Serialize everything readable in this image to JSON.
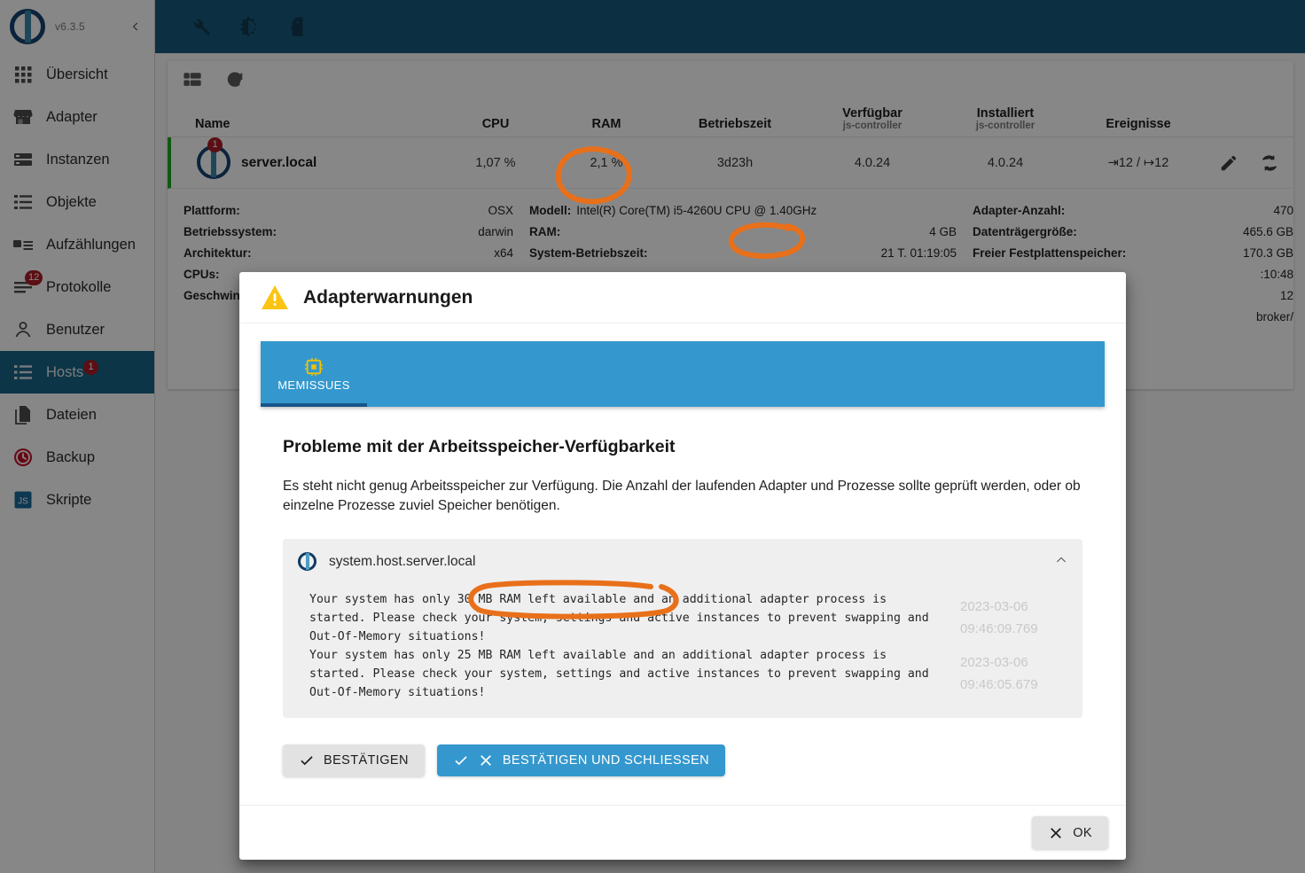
{
  "app": {
    "version": "v6.3.5",
    "logo_name": "iobroker-logo",
    "collapse_icon": "chevron-left-icon"
  },
  "appbar": {
    "icons": [
      {
        "name": "wrench-icon",
        "label": "Einstellungen"
      },
      {
        "name": "brightness-icon",
        "label": "Helligkeit"
      },
      {
        "name": "user-head-icon",
        "label": "Profil"
      }
    ]
  },
  "sidebar": {
    "items": [
      {
        "label": "Übersicht",
        "icon": "grid-dots-icon",
        "badge": null,
        "active": false
      },
      {
        "label": "Adapter",
        "icon": "store-icon",
        "badge": null,
        "active": false
      },
      {
        "label": "Instanzen",
        "icon": "cards-icon",
        "badge": null,
        "active": false
      },
      {
        "label": "Objekte",
        "icon": "list-icon",
        "badge": null,
        "active": false
      },
      {
        "label": "Aufzählungen",
        "icon": "enum-icon",
        "badge": null,
        "active": false
      },
      {
        "label": "Protokolle",
        "icon": "log-lines-icon",
        "badge": "12",
        "active": false
      },
      {
        "label": "Benutzer",
        "icon": "person-icon",
        "badge": null,
        "active": false
      },
      {
        "label": "Hosts",
        "icon": "hosts-icon",
        "badge": "1",
        "active": true
      },
      {
        "label": "Dateien",
        "icon": "files-icon",
        "badge": null,
        "active": false
      },
      {
        "label": "Backup",
        "icon": "backup-clock-icon",
        "badge": null,
        "active": false
      },
      {
        "label": "Skripte",
        "icon": "js-script-icon",
        "badge": null,
        "active": false
      }
    ]
  },
  "hosts_card": {
    "toolbar": [
      {
        "name": "toggle-expand-icon",
        "label": "Ansicht"
      },
      {
        "name": "refresh-icon",
        "label": "Aktualisieren"
      }
    ],
    "columns": {
      "name": "Name",
      "cpu": "CPU",
      "ram": "RAM",
      "uptime": "Betriebszeit",
      "available": "Verfügbar",
      "available_sub": "js-controller",
      "installed": "Installiert",
      "installed_sub": "js-controller",
      "events": "Ereignisse"
    },
    "row": {
      "host": "server.local",
      "host_badge": "1",
      "cpu": "1,07 %",
      "ram": "2,1 %",
      "uptime": "3d23h",
      "available": "4.0.24",
      "installed": "4.0.24",
      "events": "⇥12 / ↦12",
      "edit_icon": "pencil-icon",
      "restart_icon": "restart-icon"
    },
    "details_left": [
      {
        "key": "Plattform:",
        "value": "OSX"
      },
      {
        "key": "Betriebssystem:",
        "value": "darwin"
      },
      {
        "key": "Architektur:",
        "value": "x64"
      },
      {
        "key": "CPUs:",
        "value": ""
      },
      {
        "key": "Geschwindigkeit:",
        "value": ""
      }
    ],
    "details_mid": [
      {
        "key": "Modell:",
        "value": "Intel(R) Core(TM) i5-4260U CPU @ 1.40GHz"
      },
      {
        "key": "RAM:",
        "value": "4 GB"
      },
      {
        "key": "System-Betriebszeit:",
        "value": "21 T. 01:19:05"
      }
    ],
    "details_right": [
      {
        "key": "Adapter-Anzahl:",
        "value": "470"
      },
      {
        "key": "Datenträgergröße:",
        "value": "465.6 GB"
      },
      {
        "key": "Freier Festplattenspeicher:",
        "value": "170.3 GB"
      },
      {
        "key": "",
        "value": ":10:48"
      },
      {
        "key": "",
        "value": "12"
      },
      {
        "key": "",
        "value": "broker/"
      }
    ]
  },
  "dialog": {
    "title": "Adapterwarnungen",
    "title_icon": "warning-triangle-icon",
    "tabs": [
      {
        "label": "MEMISSUES",
        "icon": "memory-chip-icon",
        "active": true
      }
    ],
    "issue_heading": "Probleme mit der Arbeitsspeicher-Verfügbarkeit",
    "issue_text": "Es steht nicht genug Arbeitsspeicher zur Verfügung. Die Anzahl der laufenden Adapter und Prozesse sollte geprüft werden, oder ob einzelne Prozesse zuviel Speicher benötigen.",
    "source": {
      "id": "system.host.server.local",
      "logo_icon": "iobroker-mini-logo",
      "collapse_icon": "chevron-up-icon"
    },
    "messages": [
      {
        "text": "Your system has only 30 MB RAM left available and an additional adapter process is\nstarted. Please check your system, settings and active instances to prevent swapping and\nOut-Of-Memory situations!",
        "date": "2023-03-06",
        "time": "09:46:09.769"
      },
      {
        "text": "Your system has only 25 MB RAM left available and an additional adapter process is\nstarted. Please check your system, settings and active instances to prevent swapping and\nOut-Of-Memory situations!",
        "date": "2023-03-06",
        "time": "09:46:05.679"
      }
    ],
    "buttons": {
      "confirm": "BESTÄTIGEN",
      "confirm_close": "BESTÄTIGEN UND SCHLIESSEN",
      "ok": "OK"
    }
  },
  "annotations": {
    "color": "#e8701a",
    "marks": [
      {
        "name": "ram-percent-circle",
        "target": "2,1 %"
      },
      {
        "name": "ram-size-circle",
        "target": "4 GB"
      },
      {
        "name": "ram-left-circle",
        "target": "30 MB RAM left available"
      }
    ]
  }
}
